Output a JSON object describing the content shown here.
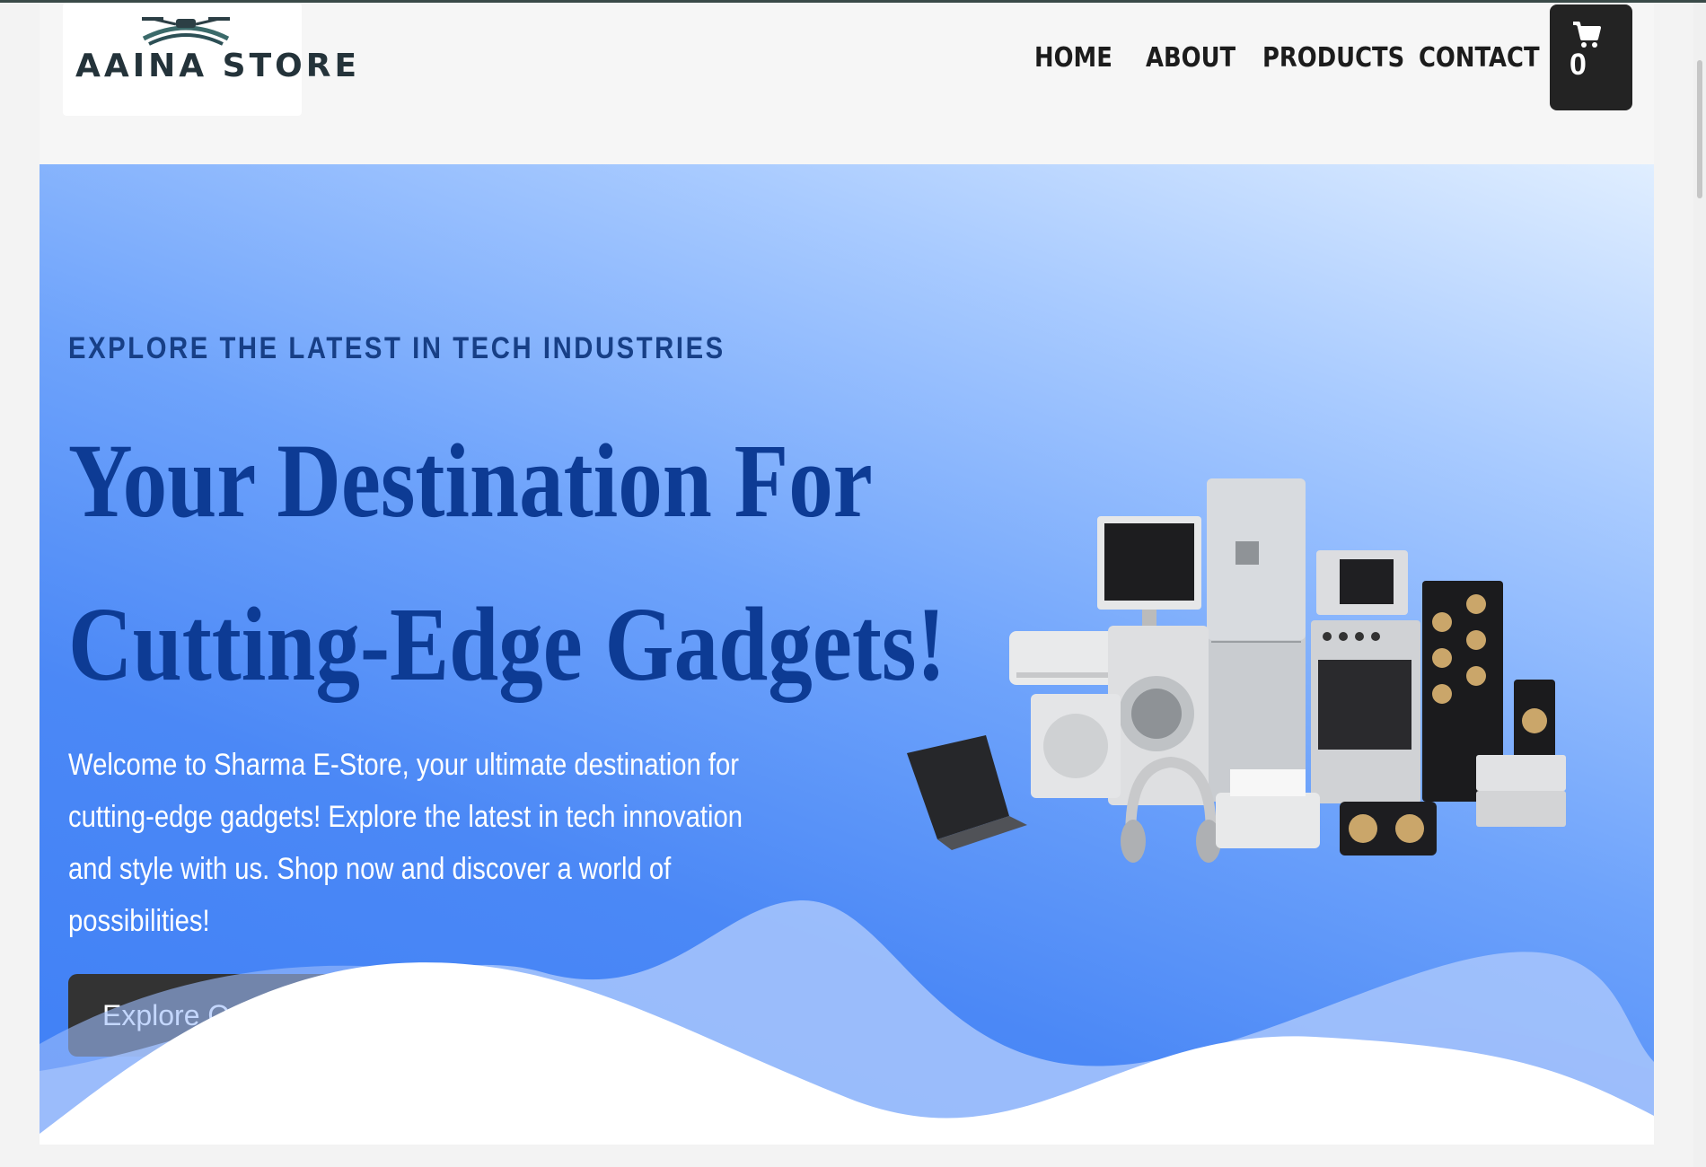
{
  "brand": {
    "name": "AAINA STORE"
  },
  "nav": {
    "items": [
      {
        "label": "HOME"
      },
      {
        "label": "ABOUT"
      },
      {
        "label": "PRODUCTS"
      },
      {
        "label": "CONTACT"
      }
    ]
  },
  "cart": {
    "count": "0",
    "icon": "cart-icon"
  },
  "hero": {
    "eyebrow": "EXPLORE THE LATEST IN TECH INDUSTRIES",
    "headline_line1": "Your Destination For",
    "headline_line2": "Cutting-Edge Gadgets!",
    "description": "Welcome to Sharma E-Store, your ultimate destination for cutting-edge gadgets! Explore the latest in tech innovation and style with us. Shop now and discover a world of possibilities!",
    "cta_label": "Explore Our Products",
    "image_alt": "home appliances and gadgets"
  },
  "colors": {
    "accent_dark": "#0d3b94",
    "button_bg": "#333333",
    "cart_bg": "#232323",
    "hero_gradient_top": "#e0eeff",
    "hero_gradient_bottom": "#3f80f6"
  }
}
